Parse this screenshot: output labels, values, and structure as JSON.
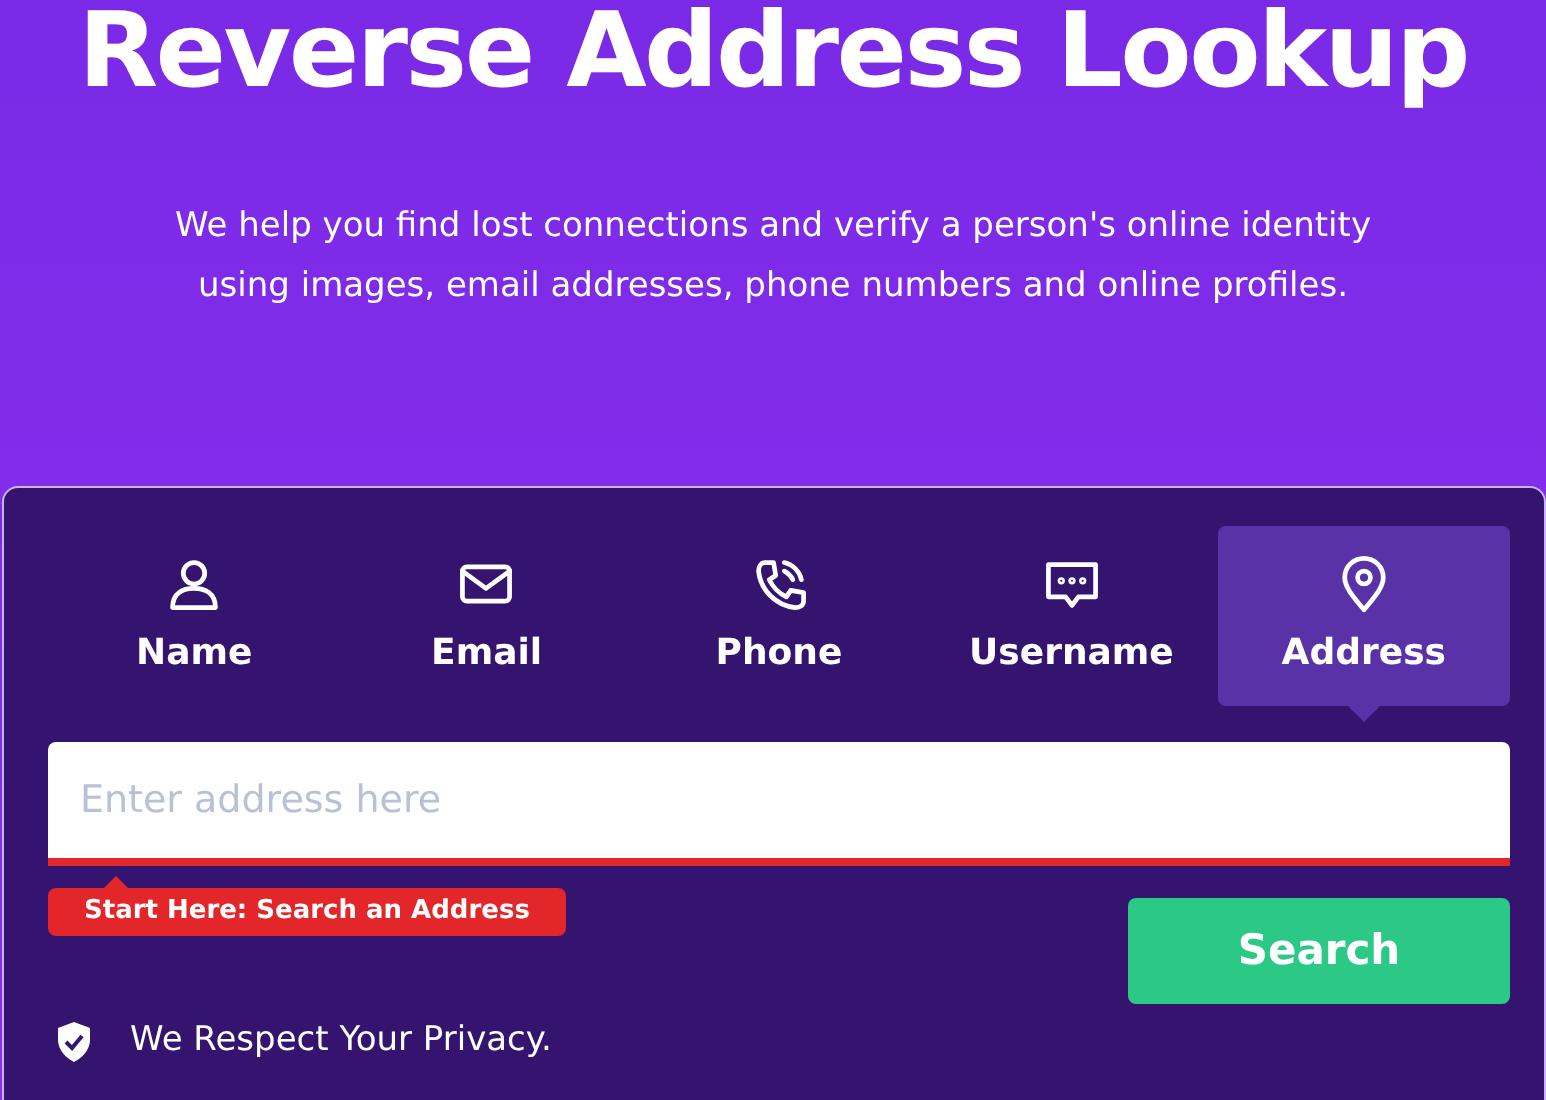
{
  "heading": "Reverse Address Lookup",
  "intro": "We help you find lost connections and verify a person's online identity using images, email addresses, phone numbers and online profiles.",
  "tabs": [
    {
      "label": "Name",
      "kind": "person",
      "selected": false
    },
    {
      "label": "Email",
      "kind": "envelope",
      "selected": false
    },
    {
      "label": "Phone",
      "kind": "phone",
      "selected": false
    },
    {
      "label": "Username",
      "kind": "chat",
      "selected": false
    },
    {
      "label": "Address",
      "kind": "pin",
      "selected": true
    }
  ],
  "search": {
    "placeholder": "Enter address here",
    "hint": "Start Here: Search an Address",
    "button": "Search"
  },
  "privacy": "We Respect Your Privacy."
}
